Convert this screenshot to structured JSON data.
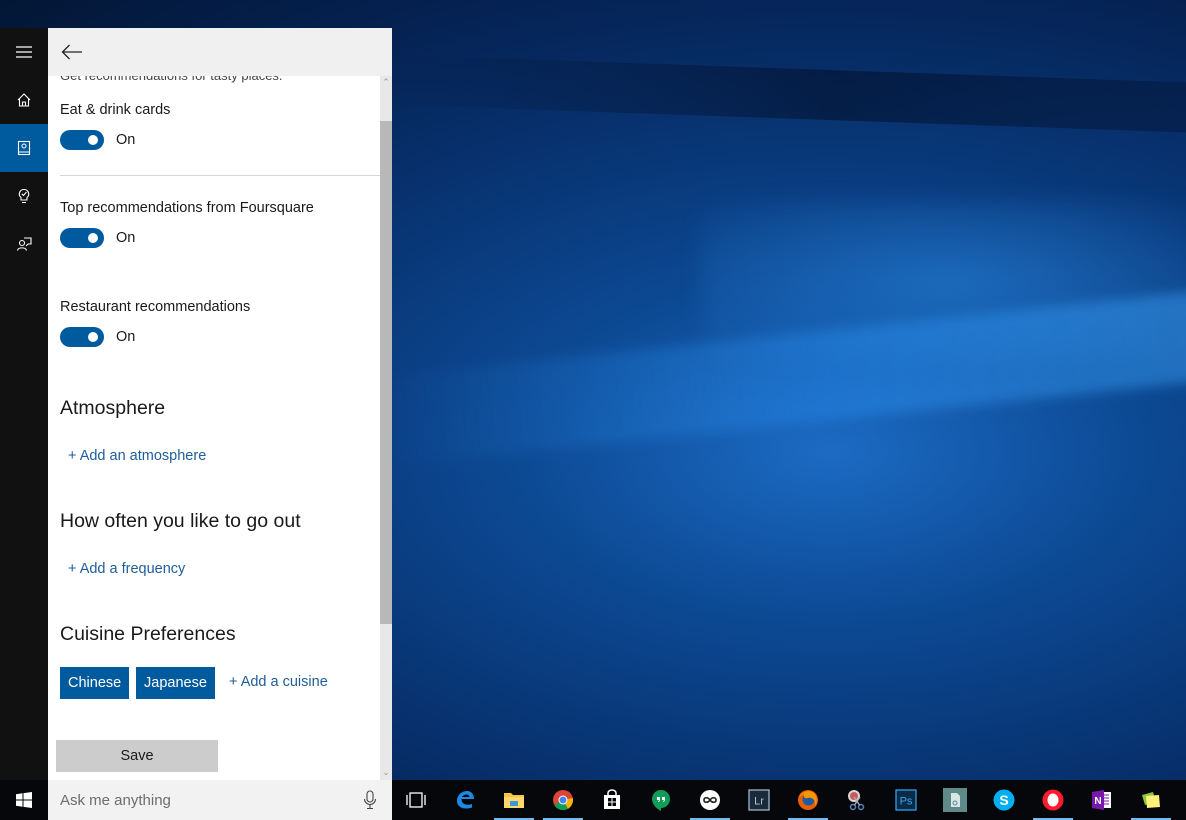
{
  "panel": {
    "truncated_description": "Get recommendations for tasty places.",
    "settings": [
      {
        "label": "Eat & drink cards",
        "state": "On",
        "enabled": true
      },
      {
        "label": "Top recommendations from Foursquare",
        "state": "On",
        "enabled": true
      },
      {
        "label": "Restaurant recommendations",
        "state": "On",
        "enabled": true
      }
    ],
    "atmosphere": {
      "title": "Atmosphere",
      "add_label": "+ Add an atmosphere"
    },
    "frequency": {
      "title": "How often you like to go out",
      "add_label": "+ Add a frequency"
    },
    "cuisine": {
      "title": "Cuisine Preferences",
      "chips": [
        "Chinese",
        "Japanese"
      ],
      "add_label": "+ Add a cuisine"
    },
    "save_label": "Save"
  },
  "rail": {
    "items": [
      {
        "name": "menu",
        "icon": "hamburger-icon"
      },
      {
        "name": "home",
        "icon": "home-icon"
      },
      {
        "name": "notebook",
        "icon": "notebook-icon",
        "active": true
      },
      {
        "name": "reminders",
        "icon": "lightbulb-icon"
      },
      {
        "name": "feedback",
        "icon": "feedback-icon"
      }
    ]
  },
  "search": {
    "placeholder": "Ask me anything"
  },
  "colors": {
    "accent": "#005a9e",
    "link": "#1f5d99",
    "rail": "#111111",
    "taskbar": "#05070b"
  },
  "taskbar": {
    "apps": [
      {
        "name": "task-view",
        "running": false
      },
      {
        "name": "edge",
        "running": false
      },
      {
        "name": "file-explorer",
        "running": true
      },
      {
        "name": "chrome",
        "running": true
      },
      {
        "name": "store",
        "running": false
      },
      {
        "name": "hangouts",
        "running": false
      },
      {
        "name": "infinity-app",
        "running": true
      },
      {
        "name": "lightroom",
        "running": false,
        "text": "Lr"
      },
      {
        "name": "firefox",
        "running": true
      },
      {
        "name": "snipping-tool",
        "running": false
      },
      {
        "name": "photoshop",
        "running": false,
        "text": "Ps"
      },
      {
        "name": "document-app",
        "running": false
      },
      {
        "name": "skype",
        "running": false,
        "text": "S"
      },
      {
        "name": "opera",
        "running": true
      },
      {
        "name": "onenote",
        "running": false,
        "text": "N"
      },
      {
        "name": "sticky-notes",
        "running": true
      }
    ]
  }
}
